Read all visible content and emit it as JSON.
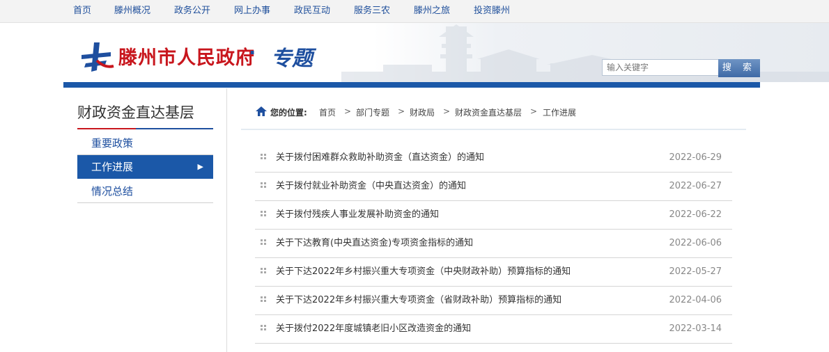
{
  "topnav": [
    "首页",
    "滕州概况",
    "政务公开",
    "网上办事",
    "政民互动",
    "服务三农",
    "滕州之旅",
    "投资滕州"
  ],
  "header": {
    "site_name": "滕州市人民政府",
    "dot": "·",
    "section": "专题",
    "search_placeholder": "输入关键字",
    "search_button": "搜 索"
  },
  "sidebar": {
    "title": "财政资金直达基层",
    "items": [
      {
        "label": "重要政策"
      },
      {
        "label": "工作进展",
        "active": true
      },
      {
        "label": "情况总结"
      }
    ]
  },
  "breadcrumb": {
    "label": "您的位置:",
    "items": [
      "首页",
      "部门专题",
      "财政局",
      "财政资金直达基层",
      "工作进展"
    ],
    "sep": ">"
  },
  "articles": [
    {
      "title": "关于拨付困难群众救助补助资金（直达资金）的通知",
      "date": "2022-06-29"
    },
    {
      "title": "关于拨付就业补助资金（中央直达资金）的通知",
      "date": "2022-06-27"
    },
    {
      "title": "关于拨付残疾人事业发展补助资金的通知",
      "date": "2022-06-22"
    },
    {
      "title": "关于下达教育(中央直达资金)专项资金指标的通知",
      "date": "2022-06-06"
    },
    {
      "title": "关于下达2022年乡村振兴重大专项资金（中央财政补助）预算指标的通知",
      "date": "2022-05-27"
    },
    {
      "title": "关于下达2022年乡村振兴重大专项资金（省财政补助）预算指标的通知",
      "date": "2022-04-06"
    },
    {
      "title": "关于拨付2022年度城镇老旧小区改造资金的通知",
      "date": "2022-03-14"
    }
  ],
  "colors": {
    "brand_blue": "#1b58a8",
    "brand_red": "#c8161d"
  }
}
